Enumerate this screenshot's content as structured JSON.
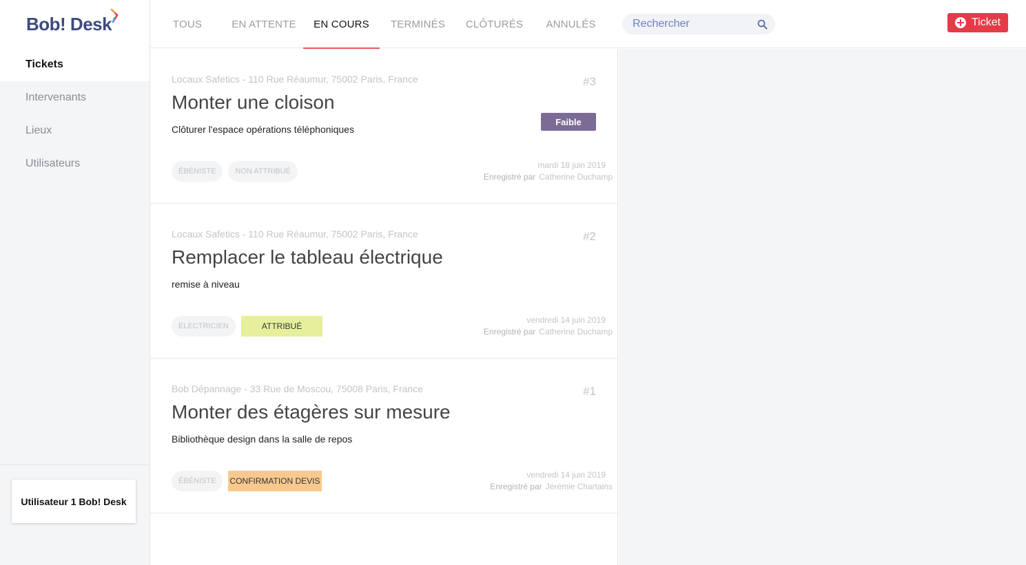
{
  "brand": {
    "name": "Bob! Desk"
  },
  "sidebar": {
    "items": [
      {
        "label": "Tickets",
        "active": true
      },
      {
        "label": "Intervenants",
        "active": false
      },
      {
        "label": "Lieux",
        "active": false
      },
      {
        "label": "Utilisateurs",
        "active": false
      }
    ],
    "user": "Utilisateur 1 Bob! Desk"
  },
  "header": {
    "tabs": [
      {
        "label": "TOUS",
        "active": false
      },
      {
        "label": "EN ATTENTE",
        "active": false
      },
      {
        "label": "EN COURS",
        "active": true
      },
      {
        "label": "TERMINÉS",
        "active": false
      },
      {
        "label": "CLÔTURÉS",
        "active": false
      },
      {
        "label": "ANNULÉS",
        "active": false
      }
    ],
    "search": {
      "placeholder": "Rechercher",
      "value": ""
    },
    "new_ticket_label": "Ticket"
  },
  "tickets": [
    {
      "address": "Locaux Safetics - 110 Rue Réaumur, 75002 Paris, France",
      "number": "#3",
      "title": "Monter une cloison",
      "description": "Clôturer l'espace opérations téléphoniques",
      "priority": "Faible",
      "tags": [
        "ÉBÉNISTE",
        "NON ATTRIBUÉ"
      ],
      "date": "mardi 18 juin 2019",
      "registered_label": "Enregistré par",
      "registered_by": "Catherine Duchamp"
    },
    {
      "address": "Locaux Safetics - 110 Rue Réaumur, 75002 Paris, France",
      "number": "#2",
      "title": "Remplacer le tableau électrique",
      "description": "remise à niveau",
      "priority": "",
      "tags": [
        "ELECTRICIEN",
        "ATTRIBUÉ"
      ],
      "date": "vendredi 14 juin 2019",
      "registered_label": "Enregistré par",
      "registered_by": "Catherine Duchamp"
    },
    {
      "address": "Bob Dépannage - 33 Rue de Moscou, 75008 Paris, France",
      "number": "#1",
      "title": "Monter des étagères sur mesure",
      "description": "Bibliothèque design dans la salle de repos",
      "priority": "",
      "tags": [
        "ÉBÉNISTE",
        "CONFIRMATION DEVIS"
      ],
      "date": "vendredi 14 juin 2019",
      "registered_label": "Enregistré par",
      "registered_by": "Jérémie Chartains"
    }
  ],
  "colors": {
    "accent_red": "#e53a48",
    "tab_underline": "#e25a5f",
    "priority_low": "#7b6c95",
    "status_assigned": "#e6f09c",
    "status_quote": "#f8c98f",
    "brand_blue": "#3c4a80"
  }
}
